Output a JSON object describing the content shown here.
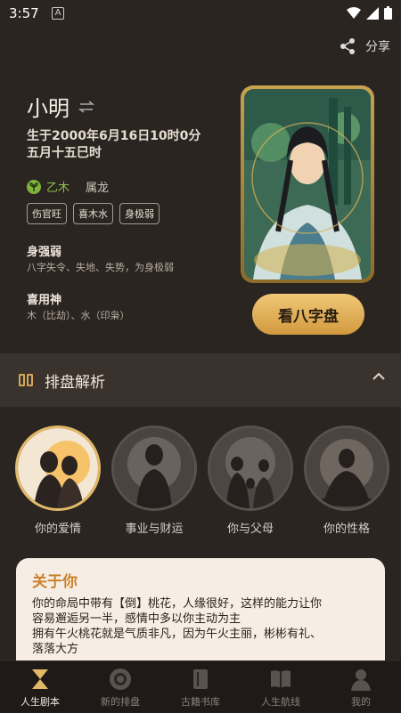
{
  "status": {
    "time": "3:57"
  },
  "header": {
    "share_label": "分享"
  },
  "profile": {
    "name": "小明",
    "birth_solar": "生于2000年6月16日10时0分",
    "birth_lunar": "五月十五巳时",
    "wuxing": "乙木",
    "zodiac": "属龙",
    "tags": [
      "伤官旺",
      "喜木水",
      "身极弱"
    ],
    "strength_title": "身强弱",
    "strength_desc": "八字失令、失地、失势，为身极弱",
    "favorable_title": "喜用神",
    "favorable_desc": "木（比劫）、水（印枭）"
  },
  "card": {
    "button_label": "看八字盘"
  },
  "section": {
    "title": "排盘解析"
  },
  "topics": [
    {
      "label": "你的爱情"
    },
    {
      "label": "事业与财运"
    },
    {
      "label": "你与父母"
    },
    {
      "label": "你的性格"
    }
  ],
  "about": {
    "title": "关于你",
    "lines": [
      "你的命局中带有【倒】桃花，人缘很好，这样的能力让你",
      "容易邂逅另一半，感情中多以你主动为主",
      "拥有午火桃花就是气质非凡，因为午火主丽，彬彬有礼、",
      "落落大方"
    ]
  },
  "tabs": [
    {
      "label": "人生剧本"
    },
    {
      "label": "新的排盘"
    },
    {
      "label": "古籍书库"
    },
    {
      "label": "人生航线"
    },
    {
      "label": "我的"
    }
  ],
  "colors": {
    "accent": "#e3b866",
    "about_title": "#c9822c",
    "wuxing_green": "#8fbf4a"
  }
}
